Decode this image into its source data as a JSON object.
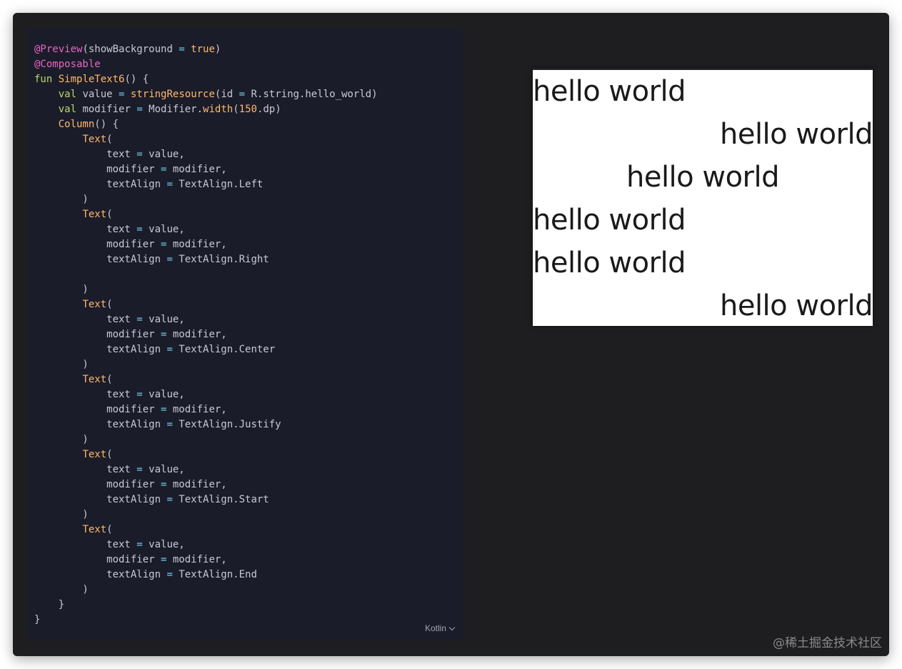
{
  "code": {
    "language_label": "Kotlin",
    "lines": [
      [
        {
          "t": "@Preview",
          "c": "annotation"
        },
        {
          "t": "(showBackground ",
          "c": "plain"
        },
        {
          "t": "=",
          "c": "operator"
        },
        {
          "t": " ",
          "c": "plain"
        },
        {
          "t": "true",
          "c": "boolean"
        },
        {
          "t": ")",
          "c": "plain"
        }
      ],
      [
        {
          "t": "@Composable",
          "c": "annotation"
        }
      ],
      [
        {
          "t": "fun",
          "c": "keyword"
        },
        {
          "t": " ",
          "c": "plain"
        },
        {
          "t": "SimpleText6",
          "c": "func"
        },
        {
          "t": "() {",
          "c": "plain"
        }
      ],
      [
        {
          "t": "    ",
          "c": "plain"
        },
        {
          "t": "val",
          "c": "keyword"
        },
        {
          "t": " value ",
          "c": "plain"
        },
        {
          "t": "=",
          "c": "operator"
        },
        {
          "t": " ",
          "c": "plain"
        },
        {
          "t": "stringResource",
          "c": "func"
        },
        {
          "t": "(id ",
          "c": "plain"
        },
        {
          "t": "=",
          "c": "operator"
        },
        {
          "t": " R.string.hello_world)",
          "c": "plain"
        }
      ],
      [
        {
          "t": "    ",
          "c": "plain"
        },
        {
          "t": "val",
          "c": "keyword"
        },
        {
          "t": " modifier ",
          "c": "plain"
        },
        {
          "t": "=",
          "c": "operator"
        },
        {
          "t": " Modifier.",
          "c": "plain"
        },
        {
          "t": "width",
          "c": "func"
        },
        {
          "t": "(",
          "c": "plain"
        },
        {
          "t": "150",
          "c": "number"
        },
        {
          "t": ".dp)",
          "c": "plain"
        }
      ],
      [
        {
          "t": "    ",
          "c": "plain"
        },
        {
          "t": "Column",
          "c": "func"
        },
        {
          "t": "() {",
          "c": "plain"
        }
      ],
      [
        {
          "t": "        ",
          "c": "plain"
        },
        {
          "t": "Text",
          "c": "func"
        },
        {
          "t": "(",
          "c": "plain"
        }
      ],
      [
        {
          "t": "            text ",
          "c": "plain"
        },
        {
          "t": "=",
          "c": "operator"
        },
        {
          "t": " value,",
          "c": "plain"
        }
      ],
      [
        {
          "t": "            modifier ",
          "c": "plain"
        },
        {
          "t": "=",
          "c": "operator"
        },
        {
          "t": " modifier,",
          "c": "plain"
        }
      ],
      [
        {
          "t": "            textAlign ",
          "c": "plain"
        },
        {
          "t": "=",
          "c": "operator"
        },
        {
          "t": " TextAlign.Left",
          "c": "plain"
        }
      ],
      [
        {
          "t": "        )",
          "c": "plain"
        }
      ],
      [
        {
          "t": "        ",
          "c": "plain"
        },
        {
          "t": "Text",
          "c": "func"
        },
        {
          "t": "(",
          "c": "plain"
        }
      ],
      [
        {
          "t": "            text ",
          "c": "plain"
        },
        {
          "t": "=",
          "c": "operator"
        },
        {
          "t": " value,",
          "c": "plain"
        }
      ],
      [
        {
          "t": "            modifier ",
          "c": "plain"
        },
        {
          "t": "=",
          "c": "operator"
        },
        {
          "t": " modifier,",
          "c": "plain"
        }
      ],
      [
        {
          "t": "            textAlign ",
          "c": "plain"
        },
        {
          "t": "=",
          "c": "operator"
        },
        {
          "t": " TextAlign.Right",
          "c": "plain"
        }
      ],
      [],
      [
        {
          "t": "        )",
          "c": "plain"
        }
      ],
      [
        {
          "t": "        ",
          "c": "plain"
        },
        {
          "t": "Text",
          "c": "func"
        },
        {
          "t": "(",
          "c": "plain"
        }
      ],
      [
        {
          "t": "            text ",
          "c": "plain"
        },
        {
          "t": "=",
          "c": "operator"
        },
        {
          "t": " value,",
          "c": "plain"
        }
      ],
      [
        {
          "t": "            modifier ",
          "c": "plain"
        },
        {
          "t": "=",
          "c": "operator"
        },
        {
          "t": " modifier,",
          "c": "plain"
        }
      ],
      [
        {
          "t": "            textAlign ",
          "c": "plain"
        },
        {
          "t": "=",
          "c": "operator"
        },
        {
          "t": " TextAlign.Center",
          "c": "plain"
        }
      ],
      [
        {
          "t": "        )",
          "c": "plain"
        }
      ],
      [
        {
          "t": "        ",
          "c": "plain"
        },
        {
          "t": "Text",
          "c": "func"
        },
        {
          "t": "(",
          "c": "plain"
        }
      ],
      [
        {
          "t": "            text ",
          "c": "plain"
        },
        {
          "t": "=",
          "c": "operator"
        },
        {
          "t": " value,",
          "c": "plain"
        }
      ],
      [
        {
          "t": "            modifier ",
          "c": "plain"
        },
        {
          "t": "=",
          "c": "operator"
        },
        {
          "t": " modifier,",
          "c": "plain"
        }
      ],
      [
        {
          "t": "            textAlign ",
          "c": "plain"
        },
        {
          "t": "=",
          "c": "operator"
        },
        {
          "t": " TextAlign.Justify",
          "c": "plain"
        }
      ],
      [
        {
          "t": "        )",
          "c": "plain"
        }
      ],
      [
        {
          "t": "        ",
          "c": "plain"
        },
        {
          "t": "Text",
          "c": "func"
        },
        {
          "t": "(",
          "c": "plain"
        }
      ],
      [
        {
          "t": "            text ",
          "c": "plain"
        },
        {
          "t": "=",
          "c": "operator"
        },
        {
          "t": " value,",
          "c": "plain"
        }
      ],
      [
        {
          "t": "            modifier ",
          "c": "plain"
        },
        {
          "t": "=",
          "c": "operator"
        },
        {
          "t": " modifier,",
          "c": "plain"
        }
      ],
      [
        {
          "t": "            textAlign ",
          "c": "plain"
        },
        {
          "t": "=",
          "c": "operator"
        },
        {
          "t": " TextAlign.Start",
          "c": "plain"
        }
      ],
      [
        {
          "t": "        )",
          "c": "plain"
        }
      ],
      [
        {
          "t": "        ",
          "c": "plain"
        },
        {
          "t": "Text",
          "c": "func"
        },
        {
          "t": "(",
          "c": "plain"
        }
      ],
      [
        {
          "t": "            text ",
          "c": "plain"
        },
        {
          "t": "=",
          "c": "operator"
        },
        {
          "t": " value,",
          "c": "plain"
        }
      ],
      [
        {
          "t": "            modifier ",
          "c": "plain"
        },
        {
          "t": "=",
          "c": "operator"
        },
        {
          "t": " modifier,",
          "c": "plain"
        }
      ],
      [
        {
          "t": "            textAlign ",
          "c": "plain"
        },
        {
          "t": "=",
          "c": "operator"
        },
        {
          "t": " TextAlign.End",
          "c": "plain"
        }
      ],
      [
        {
          "t": "        )",
          "c": "plain"
        }
      ],
      [
        {
          "t": "    }",
          "c": "plain"
        }
      ],
      [
        {
          "t": "}",
          "c": "plain"
        }
      ]
    ]
  },
  "preview": {
    "lines": [
      {
        "text": "hello world",
        "align": "left"
      },
      {
        "text": "hello world",
        "align": "right"
      },
      {
        "text": "hello world",
        "align": "center"
      },
      {
        "text": "hello world",
        "align": "left"
      },
      {
        "text": "hello world",
        "align": "left"
      },
      {
        "text": "hello world",
        "align": "right"
      }
    ]
  },
  "watermark": "@稀土掘金技术社区",
  "colors": {
    "window_bg": "#1e1e21",
    "code_bg": "#1b1c2a",
    "annotation": "#e667c0",
    "keyword": "#b6d96a",
    "function": "#ffb96b",
    "operator": "#6fd0e6",
    "plain_text": "#c9c9d4"
  }
}
